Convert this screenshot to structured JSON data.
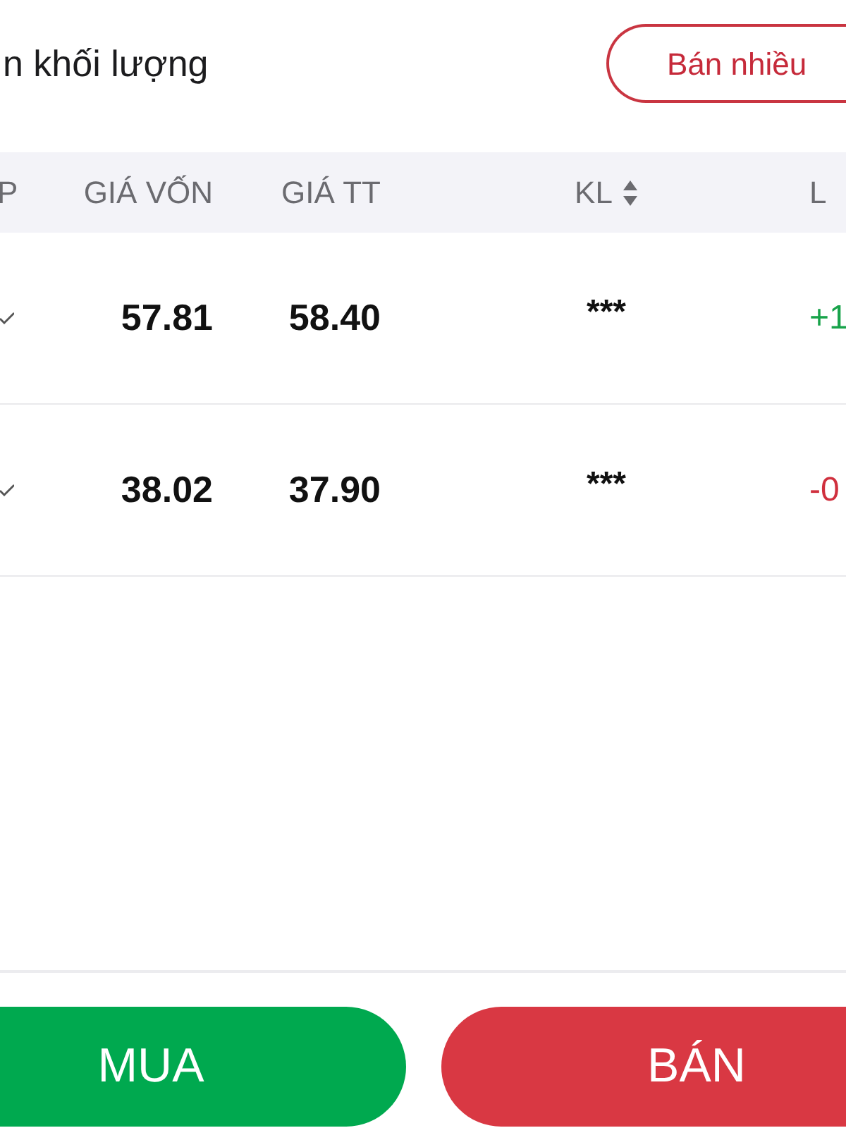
{
  "toolbar": {
    "hide_volume_label": "n khối lượng",
    "sell_multiple_button": "Bán nhiều"
  },
  "table": {
    "columns": [
      {
        "label": "P",
        "sortable": false
      },
      {
        "label": "GIÁ VỐN",
        "sortable": false
      },
      {
        "label": "GIÁ TT",
        "sortable": false
      },
      {
        "label": "KL",
        "sortable": true
      },
      {
        "label": "L",
        "sortable": false
      }
    ],
    "rows": [
      {
        "cost_price": "57.81",
        "market_price": "58.40",
        "volume": "***",
        "column_5": "+1",
        "color": "#18a34a"
      },
      {
        "cost_price": "38.02",
        "market_price": "37.90",
        "volume": "***",
        "column_5": "-0",
        "color": "#d0303e"
      }
    ]
  },
  "actions": [
    {
      "label": "MUA",
      "kind": "buy"
    },
    {
      "label": "BÁN",
      "kind": "sell"
    }
  ]
}
